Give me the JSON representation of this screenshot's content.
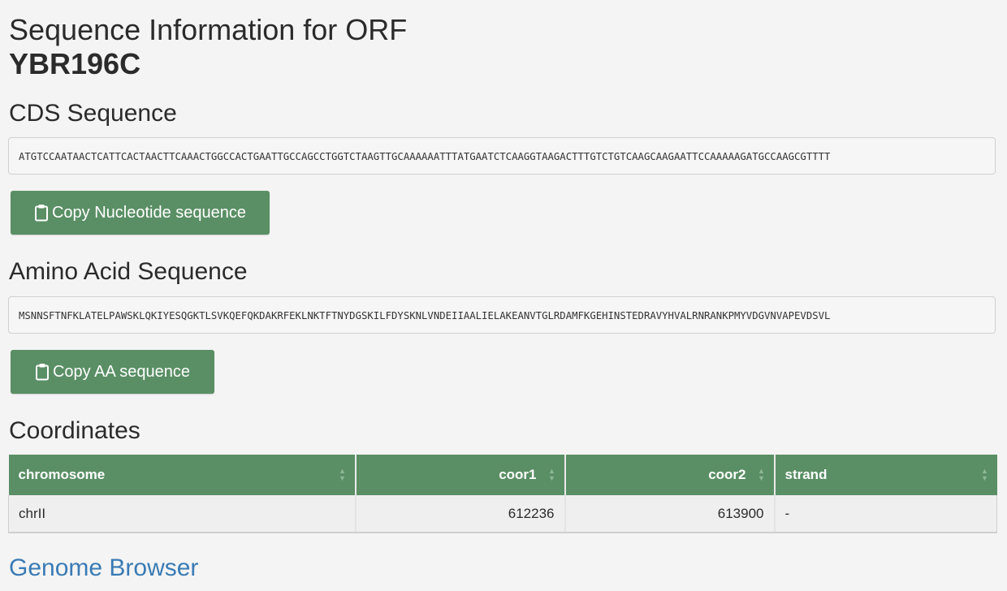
{
  "header": {
    "title": "Sequence Information for ORF",
    "orf_name": "YBR196C"
  },
  "cds": {
    "heading": "CDS Sequence",
    "sequence": "ATGTCCAATAACTCATTCACTAACTTCAAACTGGCCACTGAATTGCCAGCCTGGTCTAAGTTGCAAAAAATTTATGAATCTCAAGGTAAGACTTTGTCTGTCAAGCAAGAATTCCAAAAAGATGCCAAGCGTTTT",
    "copy_button_label": "Copy Nucleotide sequence"
  },
  "aa": {
    "heading": "Amino Acid Sequence",
    "sequence": "MSNNSFTNFKLATELPAWSKLQKIYESQGKTLSVKQEFQKDAKRFEKLNKTFTNYDGSKILFDYSKNLVNDEIIAALIELAKEANVTGLRDAMFKGEHINSTEDRAVYHVALRNRANKPMYVDGVNVAPEVDSVL",
    "copy_button_label": "Copy AA sequence"
  },
  "coordinates": {
    "heading": "Coordinates",
    "columns": [
      "chromosome",
      "coor1",
      "coor2",
      "strand"
    ],
    "rows": [
      [
        "chrII",
        "612236",
        "613900",
        "-"
      ]
    ]
  },
  "genome_browser": {
    "link_text": "Genome Browser"
  },
  "icons": {
    "copy": "clipboard-icon",
    "sort": "sort-icon"
  },
  "colors": {
    "accent": "#5a8f65",
    "link": "#3a7bb5",
    "background": "#f4f4f4"
  }
}
